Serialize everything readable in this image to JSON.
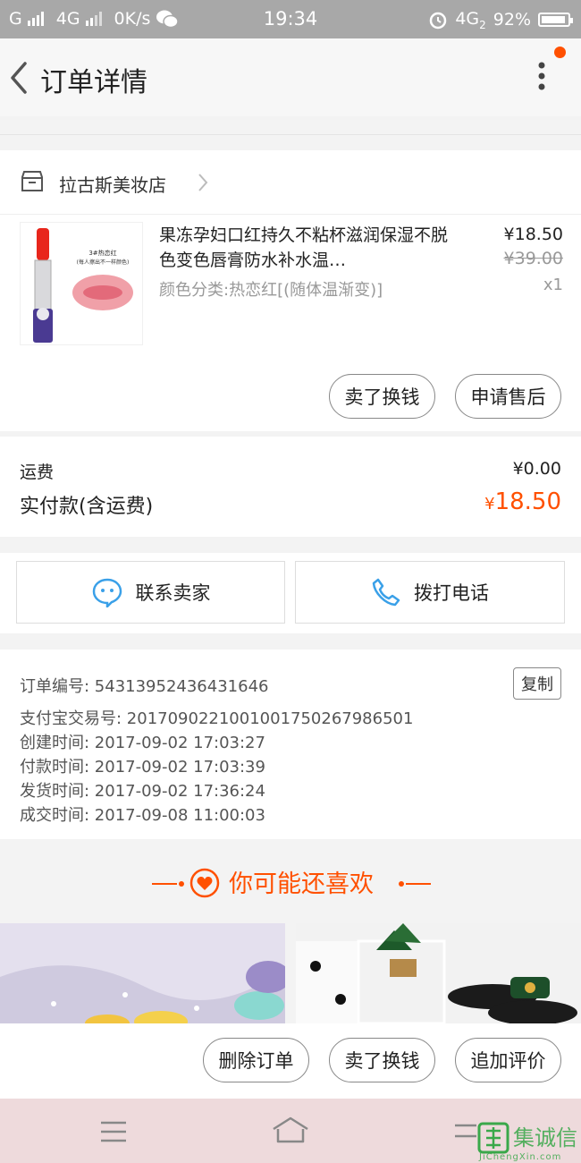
{
  "status_bar": {
    "carrier": "G",
    "network": "4G",
    "speed": "0K/s",
    "time": "19:34",
    "network2": "4G",
    "network2_sub": "2",
    "battery": "92%",
    "battery_level": 0.92
  },
  "header": {
    "title": "订单详情"
  },
  "store": {
    "name": "拉古斯美妆店"
  },
  "product": {
    "title": "果冻孕妇口红持久不粘杯滋润保湿不脱色变色唇膏防水补水温…",
    "sku": "颜色分类:热恋红[(随体温渐变)]",
    "price": "¥18.50",
    "original_price": "¥39.00",
    "quantity": "x1",
    "image_label_1": "3#热恋红",
    "image_label_2": "(每人擦出不一样颜色)"
  },
  "item_actions": {
    "sell": "卖了换钱",
    "after_sale": "申请售后"
  },
  "summary": {
    "shipping_label": "运费",
    "shipping_value": "¥0.00",
    "paid_label": "实付款(含运费)",
    "paid_currency": "¥",
    "paid_value": "18.50"
  },
  "contact": {
    "seller": "联系卖家",
    "call": "拨打电话"
  },
  "order_info": {
    "order_no": "订单编号: 54313952436431646",
    "copy": "复制",
    "alipay_no": "支付宝交易号: 2017090221001001750267986501",
    "created": "创建时间: 2017-09-02  17:03:27",
    "paid": "付款时间: 2017-09-02  17:03:39",
    "shipped": "发货时间: 2017-09-02  17:36:24",
    "completed": "成交时间: 2017-09-08  11:00:03"
  },
  "recommend": {
    "title": "你可能还喜欢"
  },
  "bottom_actions": {
    "delete": "删除订单",
    "sell": "卖了换钱",
    "review": "追加评价"
  },
  "watermark": {
    "brand": "集诚信",
    "site": "JiChengXin.com"
  },
  "colors": {
    "accent": "#ff5000",
    "statusbar": "#a8a8a8",
    "navbar": "#eedadc"
  }
}
